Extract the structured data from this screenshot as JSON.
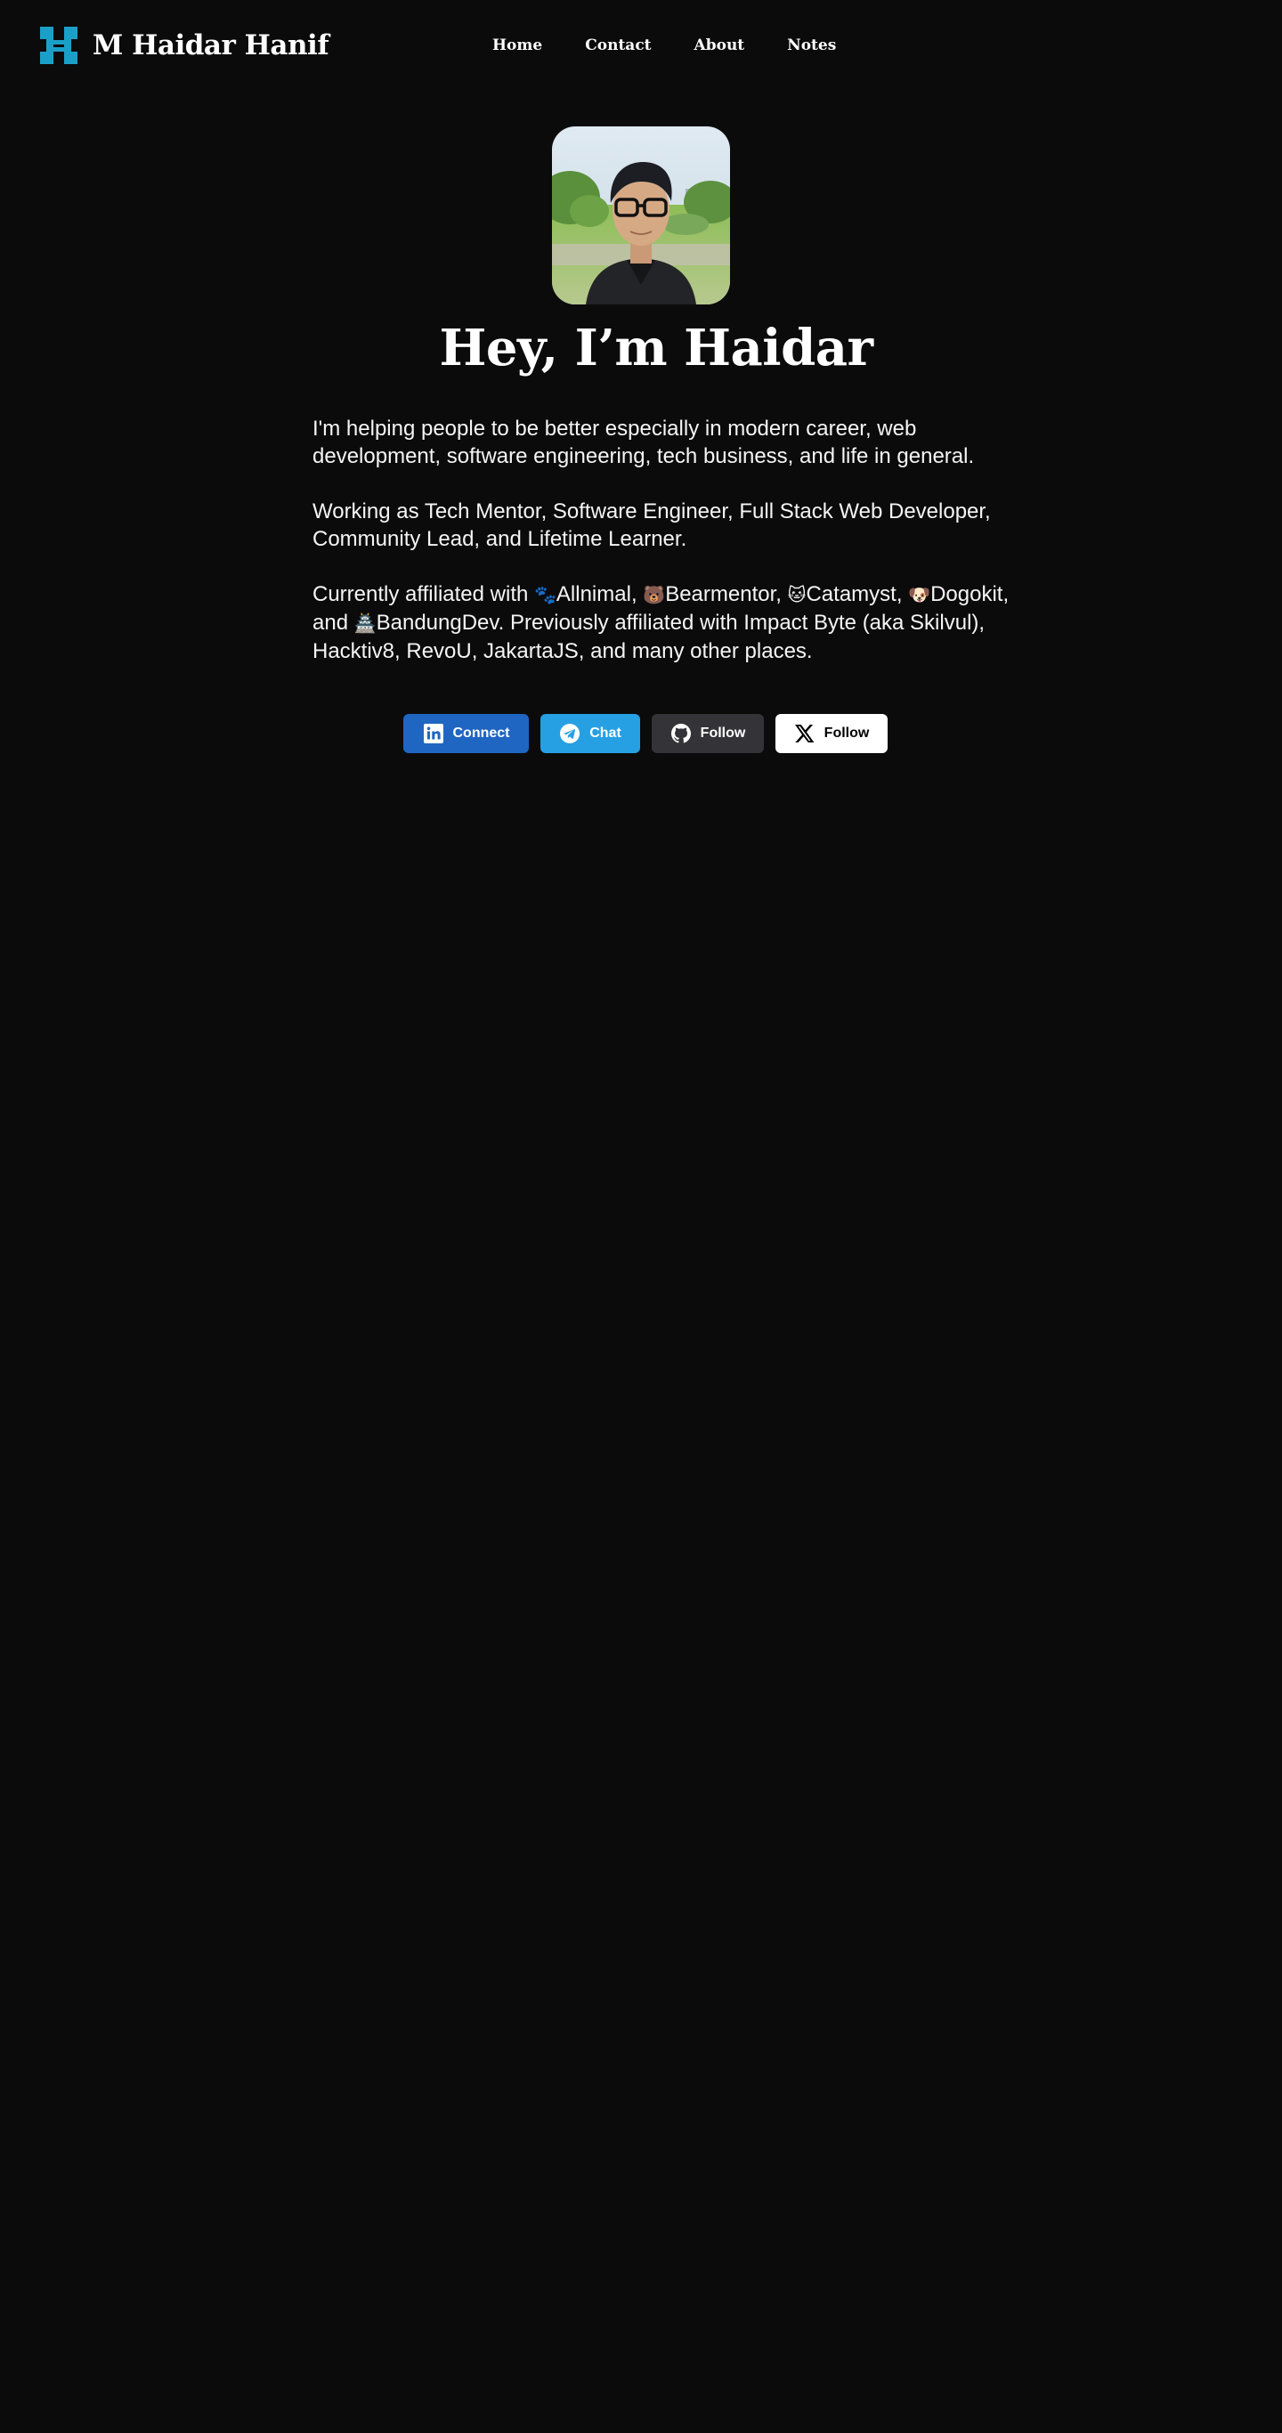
{
  "colors": {
    "background": "#0b0b0c",
    "logo": "#1aa0c8",
    "linkedin": "#1f66c3",
    "telegram": "#27a0e3",
    "github": "#333338",
    "x": "#ffffff"
  },
  "header": {
    "brand_name": "M Haidar Hanif",
    "brand_icon": "haidar-logo-icon",
    "nav": [
      {
        "label": "Home"
      },
      {
        "label": "Contact"
      },
      {
        "label": "About"
      },
      {
        "label": "Notes"
      }
    ]
  },
  "hero": {
    "avatar_icon": "profile-photo",
    "title": "Hey, I’m Haidar",
    "bio": {
      "p1": "I'm helping people to be better especially in modern career, web development, software engineering, tech business, and life in general.",
      "p2": "Working as Tech Mentor, Software Engineer, Full Stack Web Developer, Community Lead, and Lifetime Learner.",
      "p3_prefix": "Currently affiliated with ",
      "orgs": [
        {
          "emoji": "🐾",
          "name": "Allnimal",
          "sep": ", "
        },
        {
          "emoji": "🐻",
          "name": "Bearmentor",
          "sep": ", "
        },
        {
          "emoji": "🐱",
          "name": "Catamyst",
          "sep": ", "
        },
        {
          "emoji": "🐶",
          "name": "Dogokit",
          "sep": ", and "
        },
        {
          "emoji": "🏯",
          "name": "BandungDev",
          "sep": ""
        }
      ],
      "p3_suffix": ". Previously affiliated with Impact Byte (aka Skilvul), Hacktiv8, RevoU, JakartaJS, and many other places."
    }
  },
  "socials": [
    {
      "label": "Connect",
      "icon": "linkedin-icon"
    },
    {
      "label": "Chat",
      "icon": "telegram-icon"
    },
    {
      "label": "Follow",
      "icon": "github-icon"
    },
    {
      "label": "Follow",
      "icon": "x-icon"
    }
  ]
}
